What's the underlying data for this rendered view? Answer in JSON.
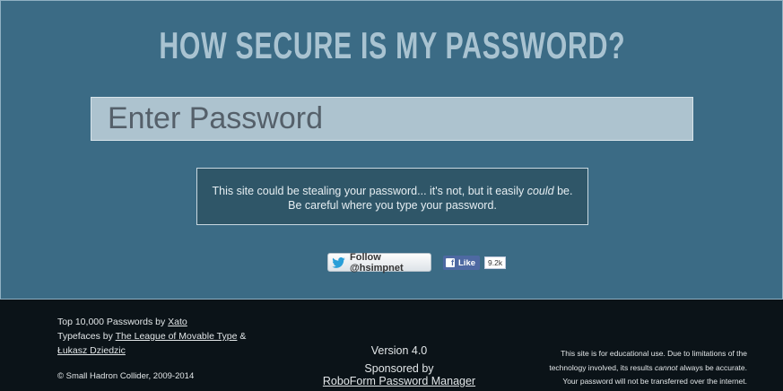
{
  "header": {
    "title": "HOW SECURE IS MY PASSWORD?"
  },
  "password": {
    "placeholder": "Enter Password",
    "value": ""
  },
  "notice": {
    "line1_a": "This site could be stealing your password... it's not, but it easily ",
    "line1_em": "could",
    "line1_b": " be.",
    "line2": "Be careful where you type your password."
  },
  "social": {
    "twitter_label": "Follow @hsimpnet",
    "facebook_label": "Like",
    "facebook_count": "9.2k"
  },
  "footer": {
    "credit1_text": "Top 10,000 Passwords by ",
    "credit1_link": "Xato",
    "credit2_text": "Typefaces by ",
    "credit2_link1": "The League of Movable Type",
    "credit2_amp": " &",
    "credit2_link2": "Łukasz Dziedzic",
    "copyright": "© Small Hadron Collider, 2009-2014",
    "version": "Version 4.0",
    "sponsored_by": "Sponsored by",
    "sponsor_link": "RoboForm Password Manager",
    "disclaimer_line1": "This site is for educational use. Due to limitations of the",
    "disclaimer_line2_a": "technology involved, its results ",
    "disclaimer_line2_em": "cannot",
    "disclaimer_line2_b": " always be accurate.",
    "disclaimer_line3": "Your password will not be transferred over the internet."
  },
  "colors": {
    "background": "#3b6b85",
    "title": "#a9c3d1",
    "input": "#adc3cf",
    "notice": "#2f5668",
    "footer": "#0b1318"
  }
}
